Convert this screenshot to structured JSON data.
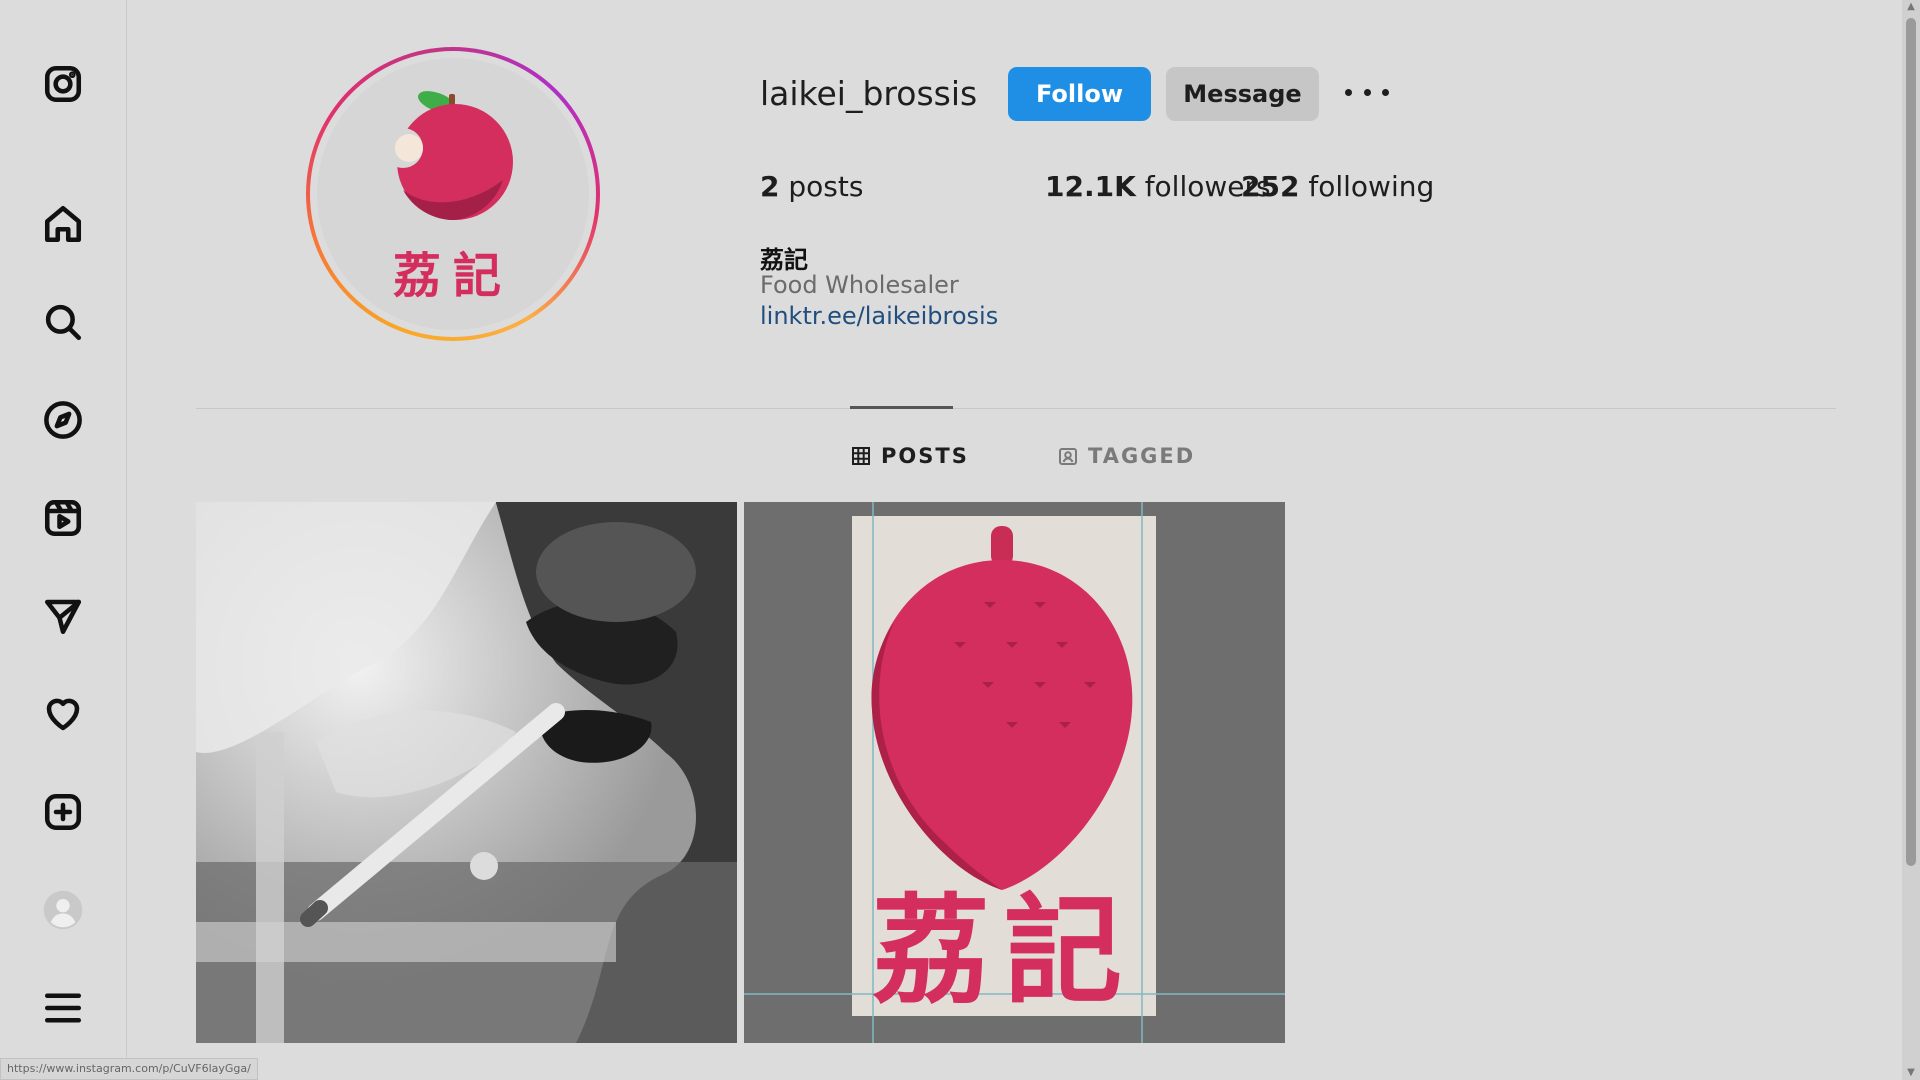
{
  "sidebar": {
    "items": [
      {
        "name": "instagram-logo-icon"
      },
      {
        "name": "home-icon"
      },
      {
        "name": "search-icon"
      },
      {
        "name": "explore-compass-icon"
      },
      {
        "name": "reels-icon"
      },
      {
        "name": "messages-send-icon"
      },
      {
        "name": "notifications-heart-icon"
      },
      {
        "name": "create-plus-icon"
      },
      {
        "name": "profile-avatar-icon"
      },
      {
        "name": "menu-hamburger-icon"
      }
    ]
  },
  "profile": {
    "avatar_text": "荔記",
    "username": "laikei_brossis",
    "follow_label": "Follow",
    "message_label": "Message",
    "stats": {
      "posts_count": "2",
      "posts_label": "posts",
      "followers_count": "12.1K",
      "followers_label": "followers",
      "following_count": "252",
      "following_label": "following"
    },
    "full_name": "荔記",
    "category": "Food Wholesaler",
    "link": "linktr.ee/laikeibrosis"
  },
  "tabs": [
    {
      "label": "POSTS",
      "icon": "grid-icon",
      "active": true
    },
    {
      "label": "TAGGED",
      "icon": "tagged-user-icon",
      "active": false
    }
  ],
  "posts": [
    {
      "description_icon": "photo-smoking-man"
    },
    {
      "description_icon": "photo-lychee-logo-print",
      "text": "荔記"
    }
  ],
  "status_bar": {
    "url": "https://www.instagram.com/p/CuVF6layGga/"
  },
  "colors": {
    "follow_button": "#1f8fe6",
    "lychee_red": "#d42e5e",
    "background": "#dcdcdc"
  }
}
